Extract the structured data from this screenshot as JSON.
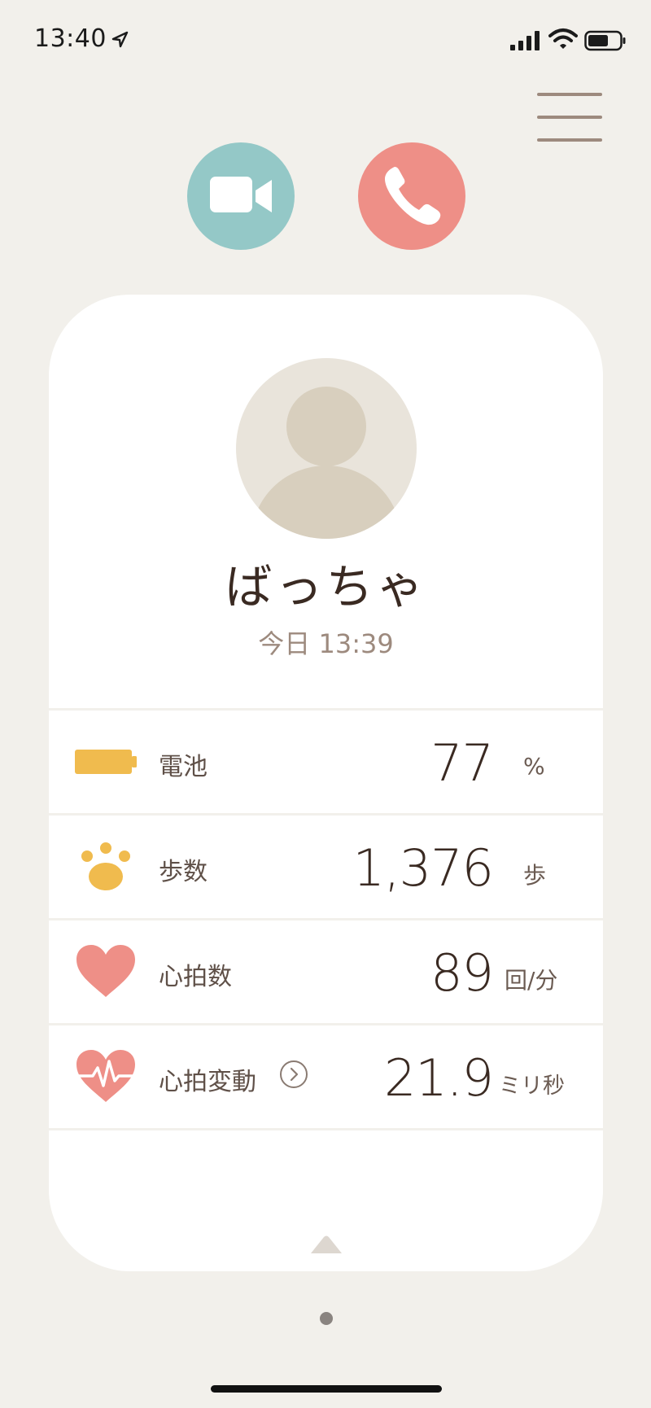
{
  "status_bar": {
    "time": "13:40",
    "icons": [
      "location-arrow-icon",
      "signal-icon",
      "wifi-icon",
      "battery-icon"
    ]
  },
  "actions": {
    "video_call": {
      "icon": "video-camera-icon",
      "color": "#94c8c7"
    },
    "voice_call": {
      "icon": "phone-icon",
      "color": "#ee8f87"
    },
    "menu": {
      "icon": "hamburger-menu-icon"
    }
  },
  "profile": {
    "name": "ばっちゃ",
    "updated": "今日 13:39",
    "avatar_icon": "person-silhouette-icon"
  },
  "stats": [
    {
      "key": "battery",
      "label": "電池",
      "value": "77",
      "unit": "%",
      "icon": "battery-full-icon",
      "color": "#f0bb4e"
    },
    {
      "key": "steps",
      "label": "歩数",
      "value": "1,376",
      "unit": "歩",
      "icon": "paw-icon",
      "color": "#f0bb4e"
    },
    {
      "key": "heart_rate",
      "label": "心拍数",
      "value": "89",
      "unit": "回/分",
      "icon": "heart-icon",
      "color": "#ee8f87"
    },
    {
      "key": "hrv",
      "label": "心拍変動",
      "value": "21.9",
      "unit": "ミリ秒",
      "icon": "heart-pulse-icon",
      "color": "#ee8f87"
    }
  ],
  "colors": {
    "background": "#f2f0eb",
    "card": "#ffffff",
    "text_primary": "#3a2a22",
    "text_secondary": "#9d8a7e"
  }
}
